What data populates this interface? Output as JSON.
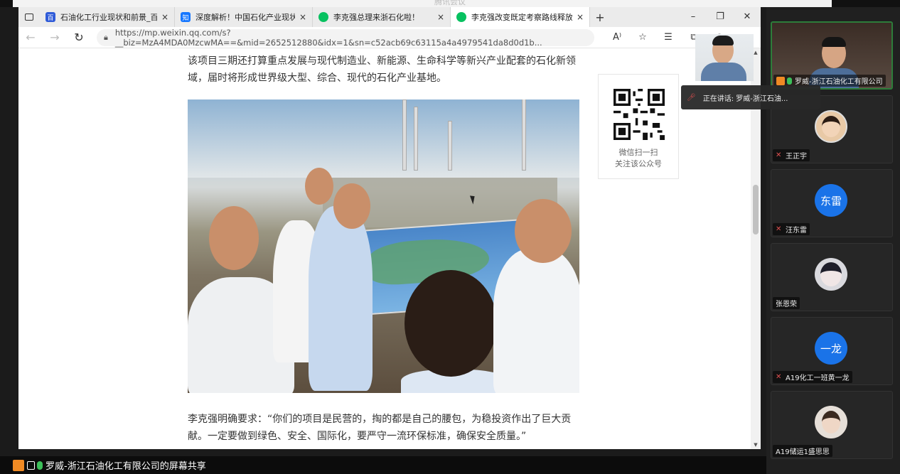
{
  "meeting": {
    "title": "腾讯会议"
  },
  "browser": {
    "tabs": [
      {
        "title": "石油化工行业现状和前景_百度搜",
        "icon": "baidu-icon",
        "color": "#2f5bd8"
      },
      {
        "title": "深度解析！中国石化产业现状及",
        "icon": "zhihu-icon",
        "color": "#1677ff"
      },
      {
        "title": "李克强总理来浙石化啦！",
        "icon": "wechat-icon",
        "color": "#07c160"
      },
      {
        "title": "李克强改变既定考察路线释放什",
        "icon": "wechat-icon",
        "color": "#07c160"
      }
    ],
    "url": "https://mp.weixin.qq.com/s?__biz=MzA4MDA0MzcwMA==&mid=2652512880&idx=1&sn=c52acb69c63115a4a4979541da8d0d1b...",
    "new_tab": "+",
    "minimize": "–",
    "maximize": "❐",
    "close": "✕",
    "tab_close": "×",
    "read_aloud": "Aͅ",
    "more": "…"
  },
  "article": {
    "para1": "该项目三期还打算重点发展与现代制造业、新能源、生命科学等新兴产业配套的石化新领域，届时将形成世界级大型、综合、现代的石化产业基地。",
    "para2": "李克强明确要求：“你们的项目是民营的，掏的都是自己的腰包，为稳投资作出了巨大贡献。一定要做到绿色、安全、国际化，要严守一流环保标准，确保安全质量。”",
    "qr_line1": "微信扫一扫",
    "qr_line2": "关注该公众号"
  },
  "share_label": "罗威-浙江石油化工有限公司的屏幕共享",
  "speaking": {
    "label": "正在讲话: 罗威-浙江石油..."
  },
  "participants": [
    {
      "name": "罗威-浙江石油化工有限公司",
      "type": "video",
      "muted": false,
      "host": true
    },
    {
      "name": "王正宇",
      "type": "photo",
      "muted": true
    },
    {
      "name": "汪东雷",
      "type": "initials",
      "initials": "东雷",
      "muted": true
    },
    {
      "name": "张恩荣",
      "type": "photo",
      "muted": false
    },
    {
      "name": "A19化工一班黄一龙",
      "type": "initials",
      "initials": "一龙",
      "muted": true
    },
    {
      "name": "A19储运1盛思思",
      "type": "photo",
      "muted": false
    }
  ],
  "colors": {
    "avatar_blue": "#1a73e8",
    "active_border": "#2d7d3a",
    "host_orange": "#f08a24",
    "mic_green": "#3cc05a"
  }
}
